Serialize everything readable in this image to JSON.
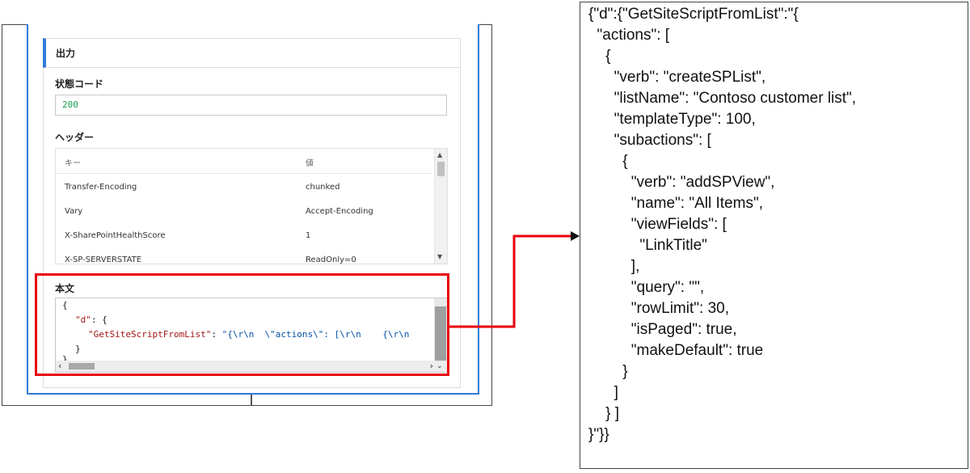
{
  "output_panel": {
    "section_title": "出力",
    "status_code_label": "状態コード",
    "status_code_value": "200",
    "headers_label": "ヘッダー",
    "headers_table": {
      "columns": [
        "キー",
        "値"
      ],
      "rows": [
        {
          "key": "Transfer-Encoding",
          "value": "chunked"
        },
        {
          "key": "Vary",
          "value": "Accept-Encoding"
        },
        {
          "key": "X-SharePointHealthScore",
          "value": "1"
        },
        {
          "key": "X-SP-SERVERSTATE",
          "value": "ReadOnly=0"
        }
      ]
    },
    "body_label": "本文",
    "body_code": {
      "line1": "{",
      "line2_key": "\"d\"",
      "line2_rest": ": {",
      "line3_key": "\"GetSiteScriptFromList\"",
      "line3_colon": ": ",
      "line3_value": "\"{\\r\\n  \\\"actions\\\": [\\r\\n    {\\r\\n",
      "line4": "}",
      "line5": "}"
    }
  },
  "json_panel": {
    "lines": [
      "{\"d\":{\"GetSiteScriptFromList\":\"{",
      "  \"actions\": [",
      "    {",
      "      \"verb\": \"createSPList\",",
      "      \"listName\": \"Contoso customer list\",",
      "      \"templateType\": 100,",
      "      \"subactions\": [",
      "        {",
      "          \"verb\": \"addSPView\",",
      "          \"name\": \"All Items\",",
      "          \"viewFields\": [",
      "            \"LinkTitle\"",
      "          ],",
      "          \"query\": \"\",",
      "          \"rowLimit\": 30,",
      "          \"isPaged\": true,",
      "          \"makeDefault\": true",
      "        }",
      "      ]",
      "    } ]",
      "}\"}}"
    ]
  },
  "colors": {
    "accent_blue": "#2f7bd6",
    "highlight_red": "#e8000b",
    "status_green": "#1a9a4a",
    "json_key": "#a31515",
    "json_string": "#0451a5"
  }
}
